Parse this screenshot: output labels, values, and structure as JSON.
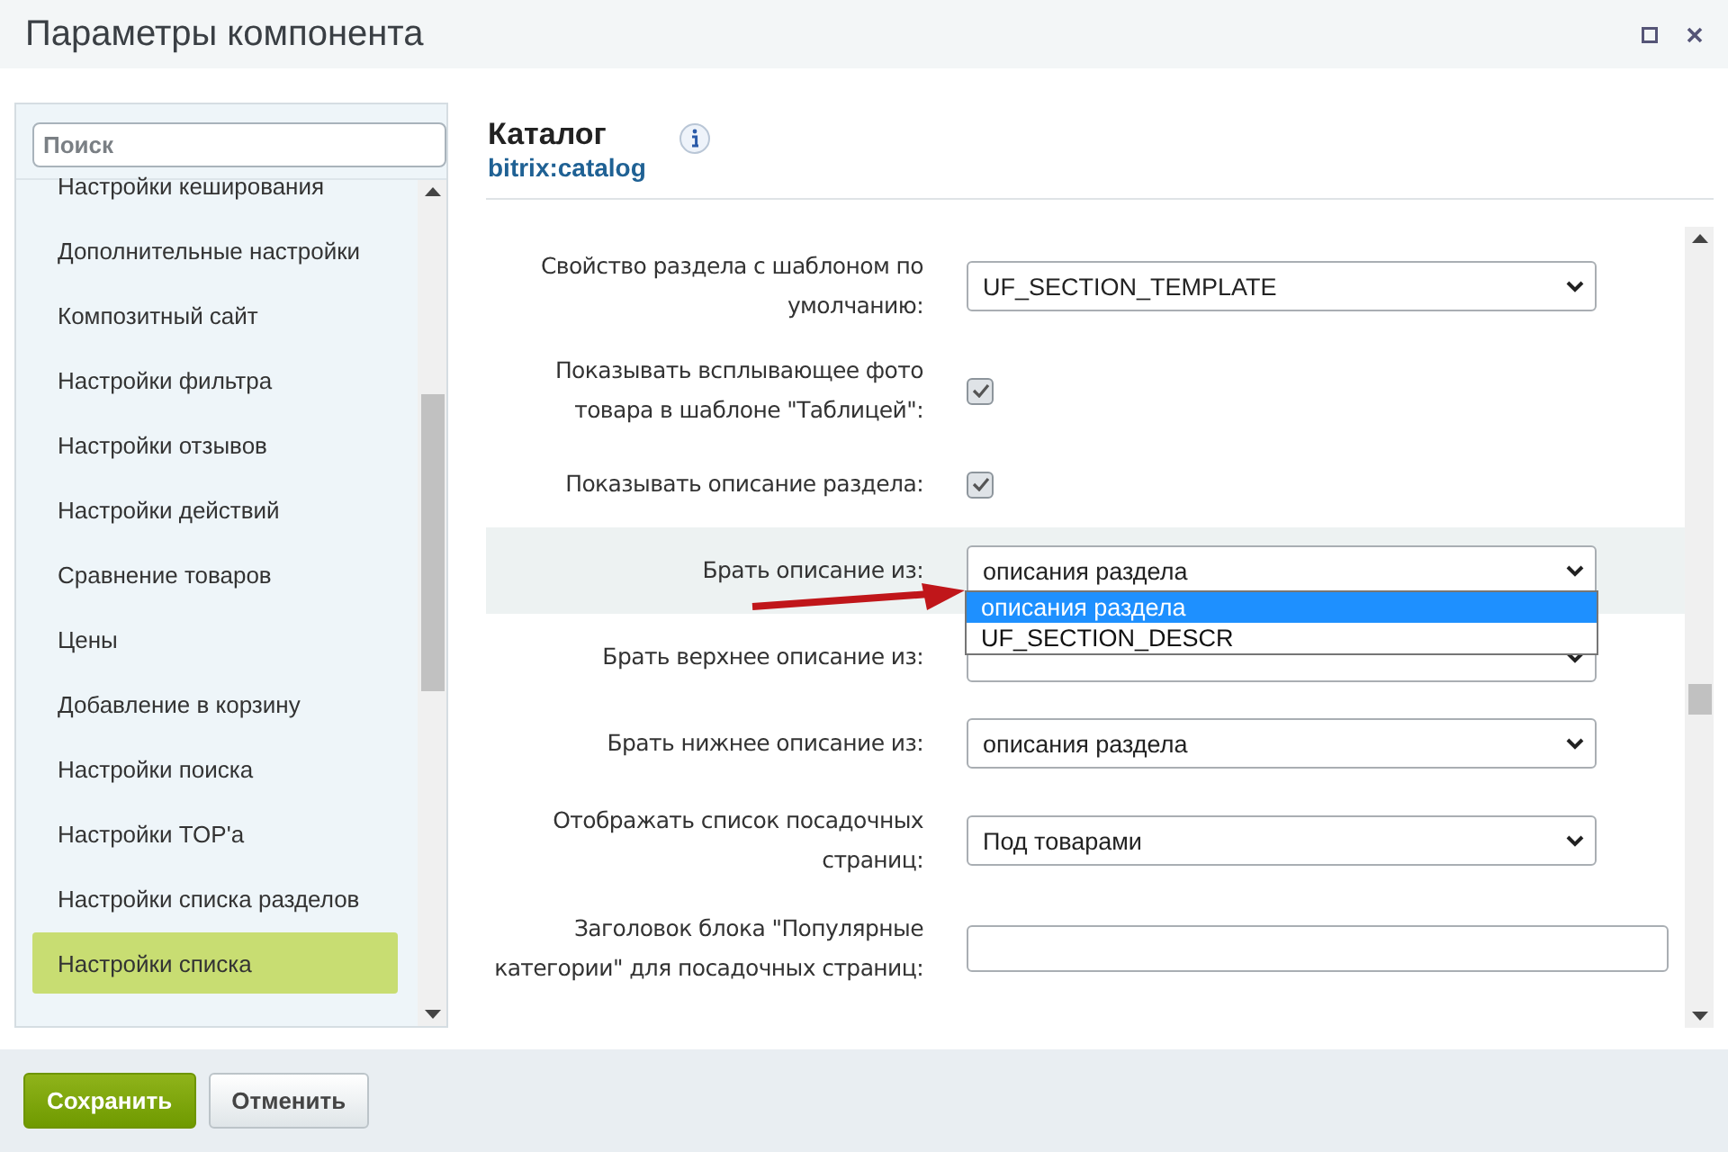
{
  "window": {
    "title": "Параметры компонента"
  },
  "sidebar": {
    "search": {
      "placeholder": "Поиск"
    },
    "items": [
      {
        "label": "Настройки кеширования",
        "selected": false
      },
      {
        "label": "Дополнительные настройки",
        "selected": false
      },
      {
        "label": "Композитный сайт",
        "selected": false
      },
      {
        "label": "Настройки фильтра",
        "selected": false
      },
      {
        "label": "Настройки отзывов",
        "selected": false
      },
      {
        "label": "Настройки действий",
        "selected": false
      },
      {
        "label": "Сравнение товаров",
        "selected": false
      },
      {
        "label": "Цены",
        "selected": false
      },
      {
        "label": "Добавление в корзину",
        "selected": false
      },
      {
        "label": "Настройки поиска",
        "selected": false
      },
      {
        "label": "Настройки TOP'а",
        "selected": false
      },
      {
        "label": "Настройки списка разделов",
        "selected": false
      },
      {
        "label": "Настройки списка",
        "selected": true
      }
    ]
  },
  "component": {
    "title": "Каталог",
    "code": "bitrix:catalog"
  },
  "fields": [
    {
      "kind": "select",
      "label": "Свойство раздела с шаблоном по умолчанию:",
      "value": "UF_SECTION_TEMPLATE",
      "highlighted": false
    },
    {
      "kind": "checkbox",
      "label": "Показывать всплывающее фото товара в шаблоне \"Таблицей\":",
      "checked": true,
      "highlighted": false
    },
    {
      "kind": "checkbox",
      "label": "Показывать описание раздела:",
      "checked": true,
      "highlighted": false
    },
    {
      "kind": "select",
      "label": "Брать описание из:",
      "value": "описания раздела",
      "highlighted": true,
      "options": [
        {
          "label": "описания раздела",
          "selected": true
        },
        {
          "label": "UF_SECTION_DESCR",
          "selected": false
        }
      ]
    },
    {
      "kind": "select",
      "label": "Брать верхнее описание из:",
      "highlighted": false
    },
    {
      "kind": "select",
      "label": "Брать нижнее описание из:",
      "value": "описания раздела",
      "highlighted": false
    },
    {
      "kind": "select",
      "label": "Отображать список посадочных страниц:",
      "value": "Под товарами",
      "highlighted": false
    },
    {
      "kind": "text",
      "label": "Заголовок блока \"Популярные категории\" для посадочных страниц:",
      "highlighted": false
    }
  ],
  "buttons": [
    {
      "label": "Сохранить",
      "kind": "primary"
    },
    {
      "label": "Отменить",
      "kind": "secondary"
    }
  ]
}
